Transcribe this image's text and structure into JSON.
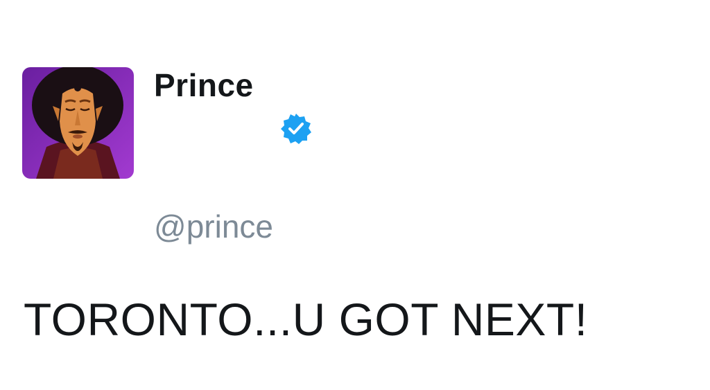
{
  "tweet": {
    "display_name": "Prince",
    "handle": "@prince",
    "verified": true,
    "text": "TORONTO...U GOT NEXT!",
    "avatar_icon": "prince-avatar-icon",
    "verified_icon": "verified-badge-icon"
  },
  "colors": {
    "background": "#ffffff",
    "name": "#14171a",
    "handle": "#7d8a96",
    "verified": "#1da1f2",
    "avatar_purple": "#8a2bb8"
  }
}
